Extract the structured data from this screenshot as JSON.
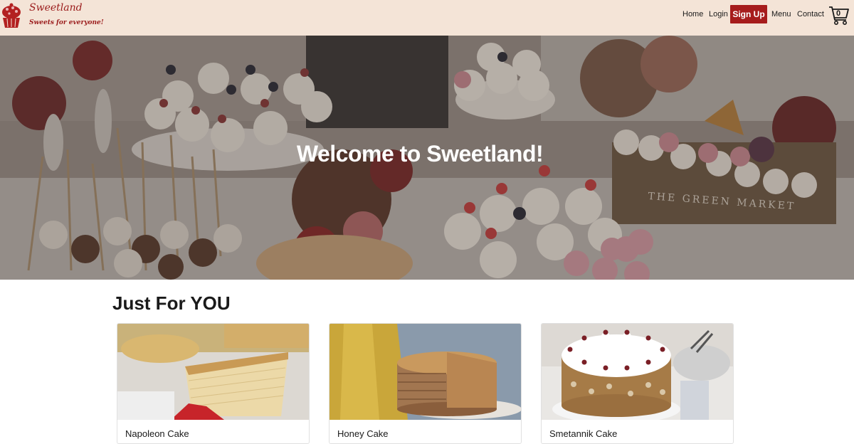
{
  "brand": {
    "name": "Sweetland",
    "tagline": "Sweets for everyone!",
    "logo_icon": "cupcake-icon"
  },
  "nav": {
    "home": "Home",
    "login": "Login",
    "signup": "Sign Up",
    "menu": "Menu",
    "contact": "Contact",
    "cart_count": "0",
    "cart_icon": "cart-icon"
  },
  "hero": {
    "title": "Welcome to Sweetland!",
    "sign_text": "THE GREEN MARKET"
  },
  "section": {
    "title": "Just For YOU"
  },
  "products": [
    {
      "name": "Napoleon Cake"
    },
    {
      "name": "Honey Cake"
    },
    {
      "name": "Smetannik Cake"
    }
  ],
  "colors": {
    "navbar_bg": "#f4e4d7",
    "accent": "#a61c1c",
    "text": "#1a1a1a"
  }
}
